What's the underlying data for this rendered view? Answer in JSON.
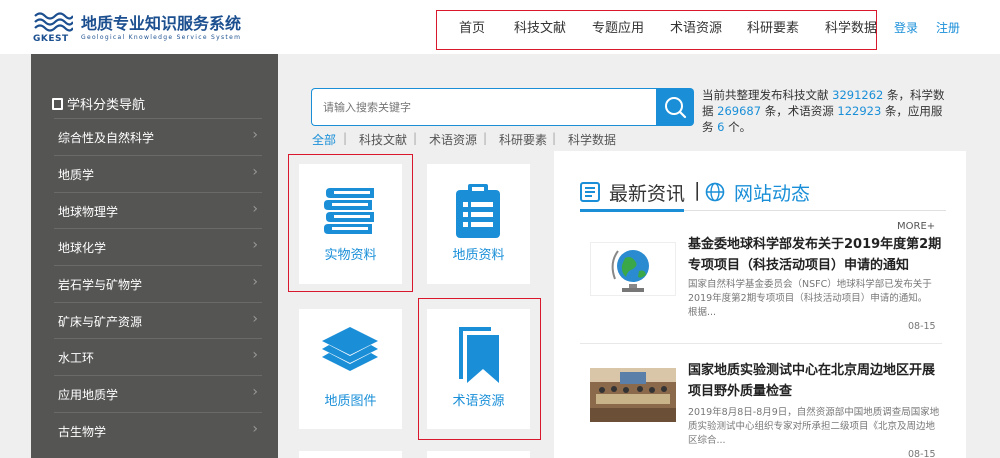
{
  "header": {
    "logo_abbr": "GKEST",
    "logo_title": "地质专业知识服务系统",
    "logo_subtitle": "Geological Knowledge Service System",
    "nav": [
      "首页",
      "科技文献",
      "专题应用",
      "术语资源",
      "科研要素",
      "科学数据"
    ],
    "login": "登录",
    "register": "注册"
  },
  "sidebar": {
    "title": "学科分类导航",
    "items": [
      "综合性及自然科学",
      "地质学",
      "地球物理学",
      "地球化学",
      "岩石学与矿物学",
      "矿床与矿产资源",
      "水工环",
      "应用地质学",
      "古生物学"
    ]
  },
  "search": {
    "placeholder": "请输入搜索关键字",
    "filters": [
      "全部",
      "科技文献",
      "术语资源",
      "科研要素",
      "科学数据"
    ]
  },
  "stats": {
    "p1": "当前共整理发布科技文献",
    "literature": "3291262",
    "p2": "条，科学数据",
    "data": "269687",
    "p3": "条，术语资源",
    "terms": "122923",
    "p4": "条，应用服务",
    "services": "6",
    "p5": "个。"
  },
  "tiles": {
    "physical": "实物资料",
    "geological": "地质资料",
    "maps": "地质图件",
    "terms": "术语资源"
  },
  "news": {
    "tab_latest": "最新资讯",
    "tab_site": "网站动态",
    "more": "MORE+",
    "articles": [
      {
        "title": "基金委地球科学部发布关于2019年度第2期专项项目（科技活动项目）申请的通知",
        "body": "国家自然科学基金委员会（NSFC）地球科学部已发布关于2019年度第2期专项项目（科技活动项目）申请的通知。　　根据...",
        "date": "08-15"
      },
      {
        "title": "国家地质实验测试中心在北京周边地区开展项目野外质量检查",
        "body": "2019年8月8日-8月9日，自然资源部中国地质调查局国家地质实验测试中心组织专家对所承担二级项目《北京及周边地区综合...",
        "date": "08-15"
      }
    ]
  },
  "colors": {
    "accent": "#1a8fd8",
    "sidebar": "#555554",
    "highlight": "#d9182d",
    "brand": "#1b4f8f"
  }
}
